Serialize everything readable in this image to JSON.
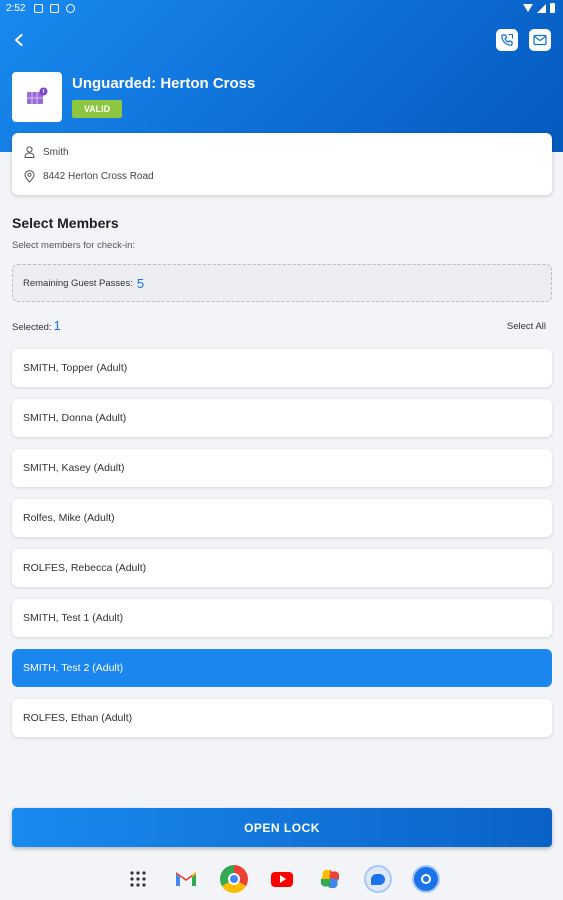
{
  "status_bar": {
    "time": "2:52"
  },
  "header": {
    "title": "Unguarded: Herton Cross",
    "badge": "VALID",
    "accent_color": "#0d6fd6",
    "icons": [
      "back-arrow-icon",
      "phone-icon",
      "mail-icon"
    ]
  },
  "location": {
    "name": "Smith",
    "address": "8442 Herton Cross Road"
  },
  "members_section": {
    "title": "Select Members",
    "subtitle": "Select members for check-in:",
    "guest_passes_label": "Remaining Guest Passes:",
    "guest_passes_count": "5",
    "selected_label": "Selected:",
    "selected_count": "1",
    "select_all_label": "Select All"
  },
  "members": [
    {
      "name": "SMITH, Topper (Adult)",
      "selected": false
    },
    {
      "name": "SMITH, Donna (Adult)",
      "selected": false
    },
    {
      "name": "SMITH, Kasey (Adult)",
      "selected": false
    },
    {
      "name": "Rolfes, Mike (Adult)",
      "selected": false
    },
    {
      "name": "ROLFES, Rebecca (Adult)",
      "selected": false
    },
    {
      "name": "SMITH, Test 1 (Adult)",
      "selected": false
    },
    {
      "name": "SMITH, Test 2 (Adult)",
      "selected": true
    },
    {
      "name": "ROLFES, Ethan (Adult)",
      "selected": false
    }
  ],
  "action": {
    "open_lock_label": "OPEN LOCK"
  },
  "dock": {
    "apps": [
      "app-drawer-icon",
      "gmail-icon",
      "chrome-icon",
      "youtube-icon",
      "photos-icon",
      "messages-icon",
      "app-icon"
    ]
  }
}
